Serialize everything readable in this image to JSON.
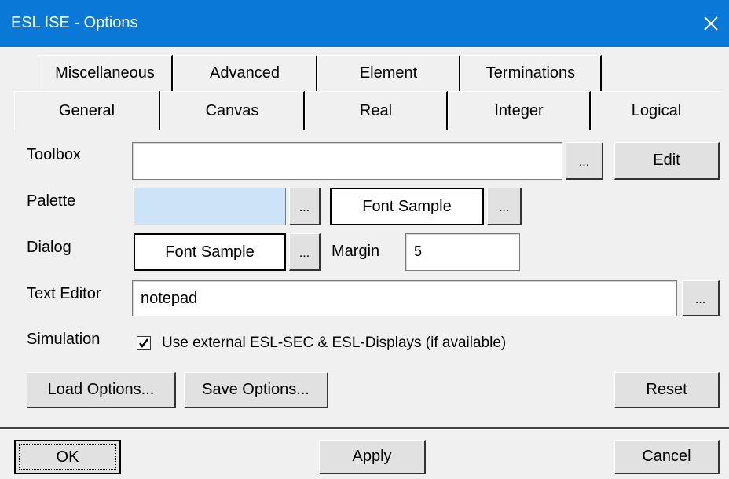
{
  "window": {
    "title": "ESL ISE - Options"
  },
  "tabs_back": [
    "Miscellaneous",
    "Advanced",
    "Element",
    "Terminations"
  ],
  "tabs_front": [
    "General",
    "Canvas",
    "Real",
    "Integer",
    "Logical"
  ],
  "active_tab": "General",
  "general": {
    "toolbox": {
      "label": "Toolbox",
      "value": "",
      "browse": "...",
      "edit": "Edit"
    },
    "palette": {
      "label": "Palette",
      "color": "#cce4f7",
      "browse": "...",
      "font_sample": "Font Sample",
      "font_browse": "..."
    },
    "dialog": {
      "label": "Dialog",
      "font_sample": "Font Sample",
      "font_browse": "...",
      "margin_label": "Margin",
      "margin_value": "5"
    },
    "text_editor": {
      "label": "Text Editor",
      "value": "notepad",
      "browse": "..."
    },
    "simulation": {
      "label": "Simulation",
      "checked": true,
      "checkbox_label": "Use external ESL-SEC & ESL-Displays (if available)"
    },
    "buttons": {
      "load": "Load Options...",
      "save": "Save Options...",
      "reset": "Reset"
    }
  },
  "footer": {
    "ok": "OK",
    "apply": "Apply",
    "cancel": "Cancel"
  },
  "colors": {
    "titlebar": "#0a78d7",
    "background": "#f0f0f0"
  }
}
